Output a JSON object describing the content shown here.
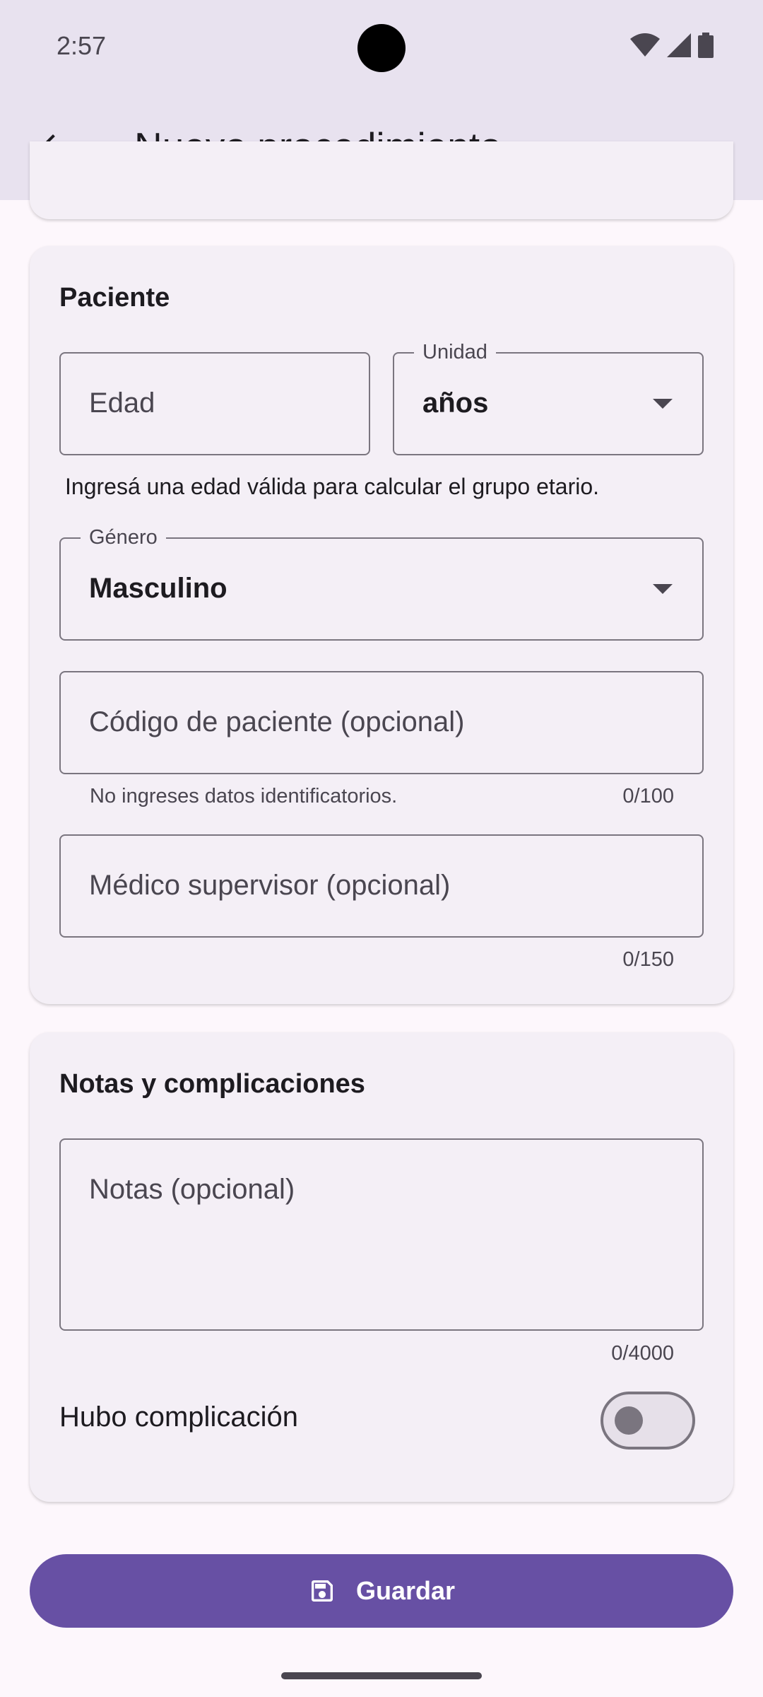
{
  "status_bar": {
    "time": "2:57"
  },
  "app_bar": {
    "title": "Nuevo procedimiento",
    "back_icon": "arrow-back-icon"
  },
  "paciente": {
    "title": "Paciente",
    "edad": {
      "placeholder": "Edad"
    },
    "unidad": {
      "label": "Unidad",
      "value": "años"
    },
    "helper": "Ingresá una edad válida para calcular el grupo etario.",
    "genero": {
      "label": "Género",
      "value": "Masculino"
    },
    "codigo": {
      "placeholder": "Código de paciente (opcional)",
      "hint": "No ingreses datos identificatorios.",
      "counter": "0/100"
    },
    "medico": {
      "placeholder": "Médico supervisor (opcional)",
      "counter": "0/150"
    }
  },
  "notas": {
    "title": "Notas y complicaciones",
    "notas_field": {
      "placeholder": "Notas (opcional)",
      "counter": "0/4000"
    },
    "complicacion": {
      "label": "Hubo complicación",
      "checked": false
    }
  },
  "actions": {
    "save_label": "Guardar",
    "save_icon": "save-icon"
  },
  "colors": {
    "primary": "#6750a4",
    "surface": "#fdf7fc",
    "card": "#f4eff6",
    "app_bar": "#e8e2ef",
    "outline": "#7a757f"
  }
}
